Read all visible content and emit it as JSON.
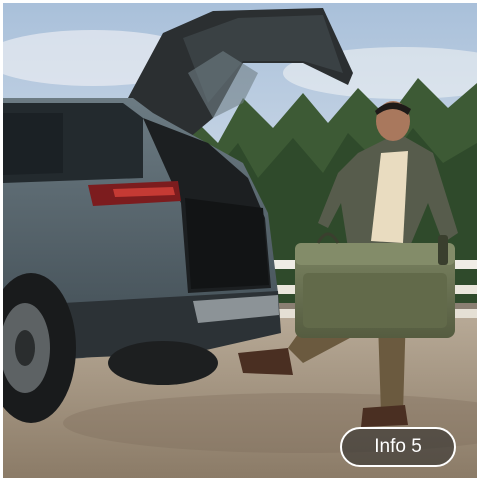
{
  "info_button": {
    "label": "Info 5"
  },
  "colors": {
    "button_border": "#ffffff",
    "button_text": "#ffffff",
    "vehicle_body": "#55636b",
    "cooler": "#68704f",
    "sky": "#b9cbe0"
  }
}
